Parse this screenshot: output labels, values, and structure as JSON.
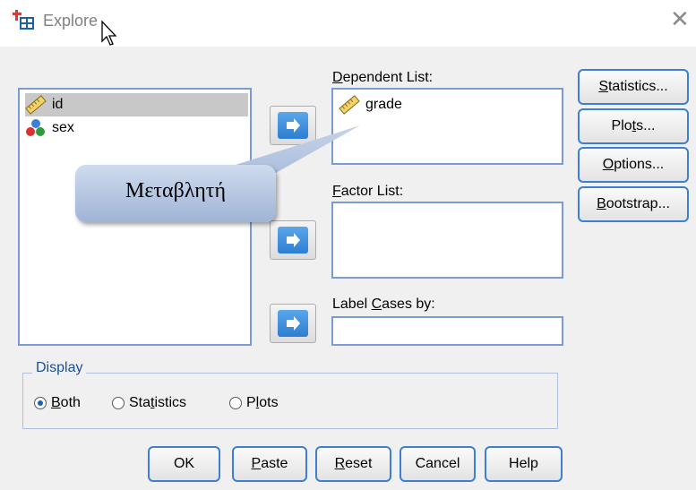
{
  "window": {
    "title": "Explore",
    "close_symbol": "✕"
  },
  "variables_list": {
    "items": [
      {
        "name": "id",
        "icon": "ruler-scale-icon",
        "selected": true
      },
      {
        "name": "sex",
        "icon": "nominal-balls-icon",
        "selected": false
      }
    ]
  },
  "dependent_list": {
    "label_prefix": "",
    "label_accel": "D",
    "label_rest": "ependent List:",
    "items": [
      {
        "name": "grade",
        "icon": "ruler-scale-icon"
      }
    ]
  },
  "factor_list": {
    "label_accel": "F",
    "label_rest": "actor List:"
  },
  "label_cases": {
    "label_prefix": "Label ",
    "label_accel": "C",
    "label_rest": "ases by:"
  },
  "side_buttons": {
    "statistics": {
      "accel": "S",
      "rest": "tatistics..."
    },
    "plots": {
      "pre": "Plo",
      "accel": "t",
      "rest": "s..."
    },
    "options": {
      "accel": "O",
      "rest": "ptions..."
    },
    "bootstrap": {
      "accel": "B",
      "rest": "ootstrap..."
    }
  },
  "callout": {
    "text": "Μεταβλητή"
  },
  "display": {
    "title": "Display",
    "options": [
      {
        "pre": "",
        "accel": "B",
        "rest": "oth",
        "checked": true
      },
      {
        "pre": "Sta",
        "accel": "t",
        "rest": "istics",
        "checked": false
      },
      {
        "pre": "P",
        "accel": "l",
        "rest": "ots",
        "checked": false
      }
    ]
  },
  "bottom_buttons": {
    "ok": "OK",
    "paste": {
      "accel": "P",
      "rest": "aste"
    },
    "reset": {
      "accel": "R",
      "rest": "eset"
    },
    "cancel": "Cancel",
    "help": "Help"
  },
  "colors": {
    "accent_border": "#3c7fd4",
    "arrow_blue": "#2d7ed1",
    "group_title": "#1b4f9a"
  }
}
